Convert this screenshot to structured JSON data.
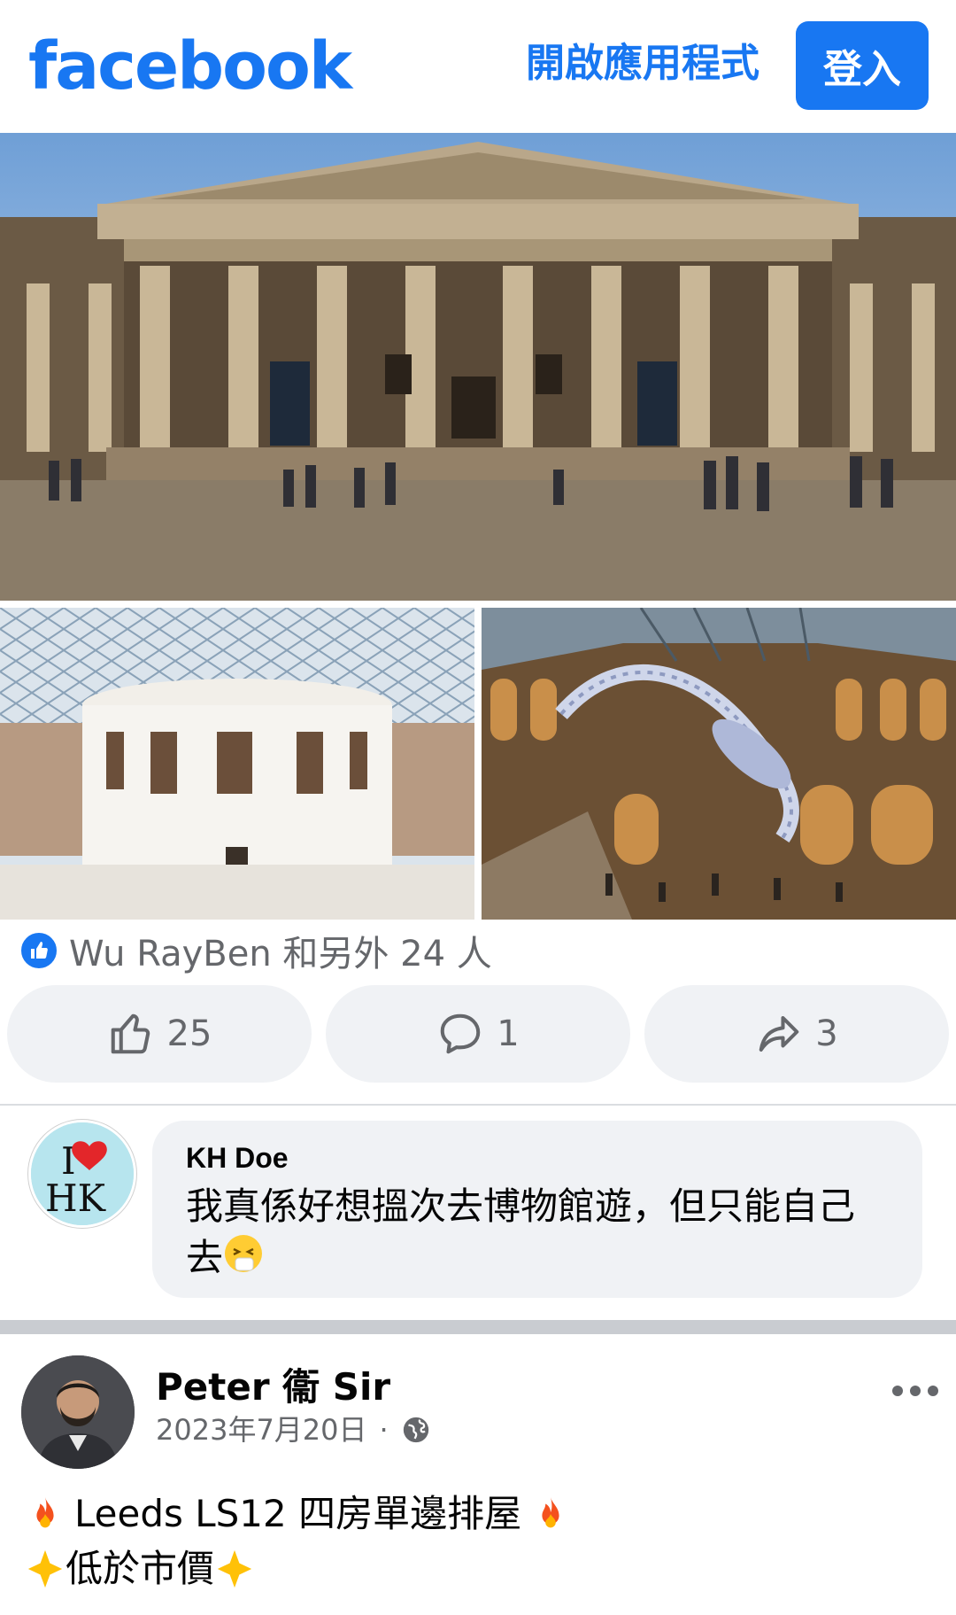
{
  "header": {
    "logo": "facebook",
    "open_app": "開啟應用程式",
    "login": "登入"
  },
  "reactions": {
    "text": "Wu RayBen 和另外 24 人"
  },
  "actions": {
    "like_count": "25",
    "comment_count": "1",
    "share_count": "3"
  },
  "comment": {
    "author": "KH Doe",
    "text": "我真係好想搵次去博物館遊，但只能自己去",
    "avatar_top": "I",
    "avatar_bottom": "HK"
  },
  "post": {
    "author": "Peter 衞 Sir",
    "date": "2023年7月20日",
    "separator": "·",
    "line1": "Leeds LS12 四房單邊排屋",
    "line2": "低於市價"
  },
  "icons": {
    "like": "thumbs-up-icon",
    "comment": "comment-bubble-icon",
    "share": "share-arrow-icon",
    "globe": "globe-icon",
    "more": "more-dots-icon",
    "fire": "fire-emoji",
    "sparkle": "sparkle-emoji",
    "sneeze": "sneezing-face-emoji"
  },
  "colors": {
    "brand": "#1877f2",
    "secondary_text": "#65676b",
    "pill_bg": "#f0f2f5"
  }
}
